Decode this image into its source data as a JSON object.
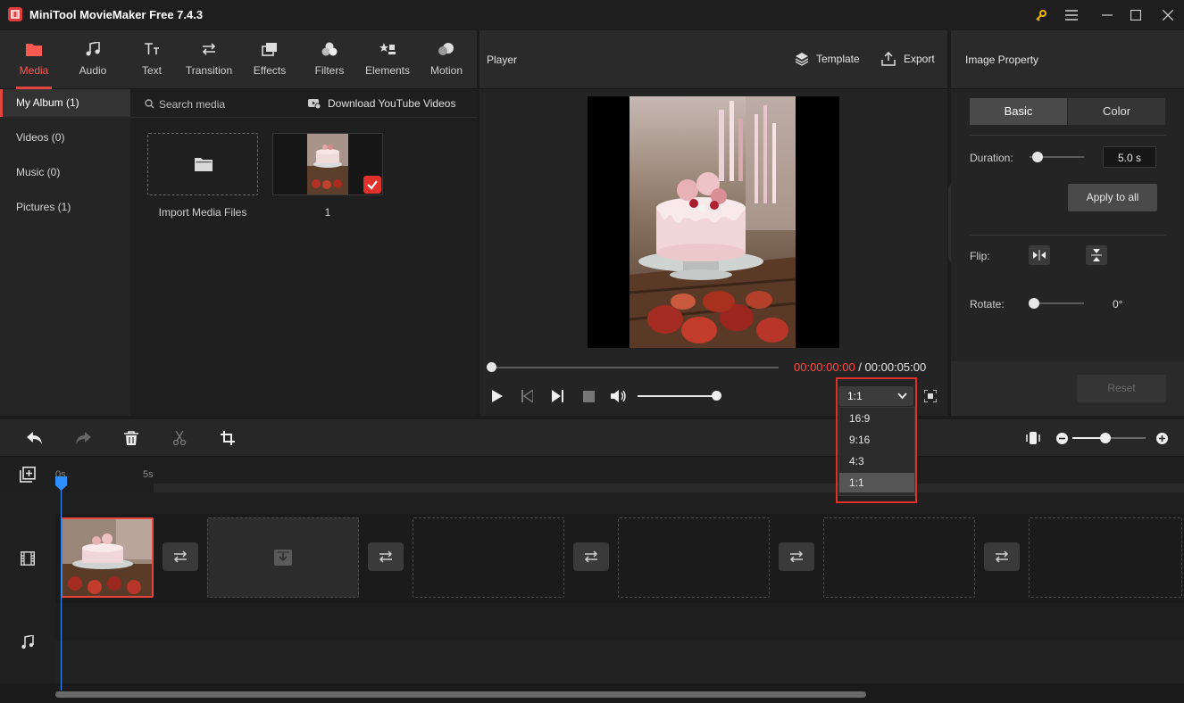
{
  "app": {
    "title": "MiniTool MovieMaker Free 7.4.3"
  },
  "toolbar_tabs": [
    {
      "label": "Media",
      "icon": "folder-icon",
      "active": true
    },
    {
      "label": "Audio",
      "icon": "music-note-icon"
    },
    {
      "label": "Text",
      "icon": "text-icon"
    },
    {
      "label": "Transition",
      "icon": "transition-arrows-icon"
    },
    {
      "label": "Effects",
      "icon": "effects-icon"
    },
    {
      "label": "Filters",
      "icon": "filters-icon"
    },
    {
      "label": "Elements",
      "icon": "elements-icon"
    },
    {
      "label": "Motion",
      "icon": "motion-icon"
    }
  ],
  "album": {
    "items": [
      {
        "label": "My Album (1)",
        "active": true
      },
      {
        "label": "Videos (0)"
      },
      {
        "label": "Music (0)"
      },
      {
        "label": "Pictures (1)"
      }
    ]
  },
  "media": {
    "search_placeholder": "Search media",
    "download_label": "Download YouTube Videos",
    "import_label": "Import Media Files",
    "clip_label": "1"
  },
  "player": {
    "title": "Player",
    "template_label": "Template",
    "export_label": "Export",
    "current_time": "00:00:00:00",
    "separator": " / ",
    "total_time": "00:00:05:00",
    "volume_level": 0.95,
    "aspect_ratio": "1:1",
    "aspect_options": [
      "16:9",
      "9:16",
      "4:3",
      "1:1"
    ]
  },
  "property": {
    "title": "Image Property",
    "tabs": [
      "Basic",
      "Color"
    ],
    "duration_label": "Duration:",
    "duration_value": "5.0 s",
    "apply_all_label": "Apply to all",
    "flip_label": "Flip:",
    "rotate_label": "Rotate:",
    "rotate_value": "0°",
    "reset_label": "Reset"
  },
  "timeline": {
    "ruler_labels": [
      "0s",
      "5s"
    ]
  },
  "colors": {
    "accent": "#e0453e",
    "highlight": "#e0302a",
    "playhead": "#2f8fff",
    "time_current": "#ff4c44"
  }
}
